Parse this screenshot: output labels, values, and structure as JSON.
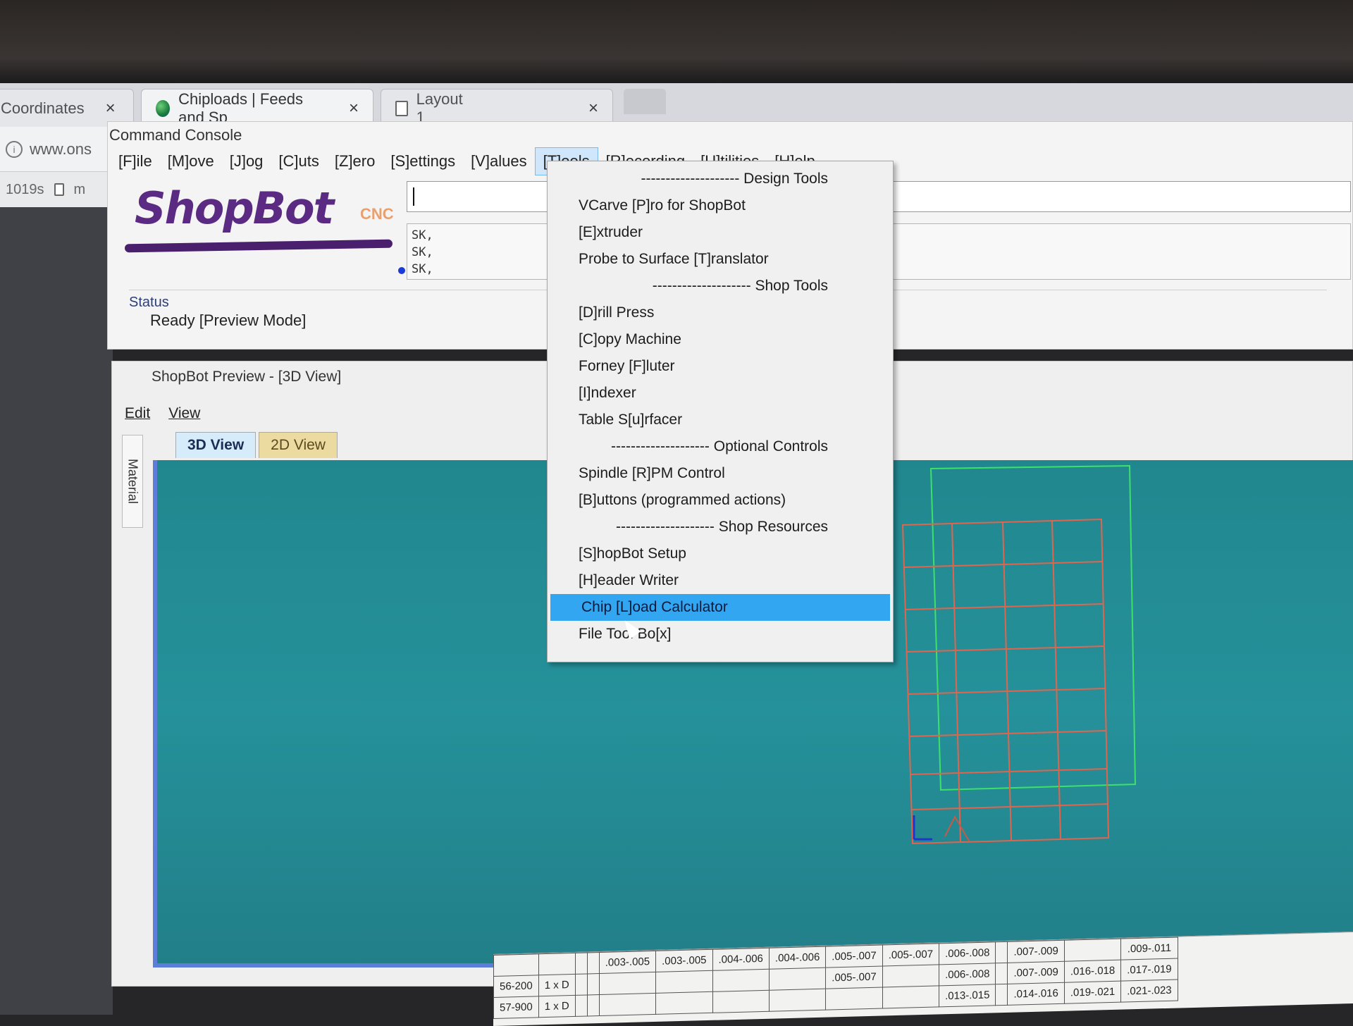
{
  "browser": {
    "tabs": [
      {
        "label": "Coordinates",
        "close": "×"
      },
      {
        "label": "Chiploads | Feeds and Sp",
        "close": "×"
      },
      {
        "label": "Layout 1",
        "close": "×"
      }
    ],
    "address": "www.ons",
    "bookmarks": [
      "1019s",
      "m"
    ]
  },
  "console": {
    "title": "Command Console",
    "menu": [
      "[F]ile",
      "[M]ove",
      "[J]og",
      "[C]uts",
      "[Z]ero",
      "[S]ettings",
      "[V]alues",
      "[T]ools",
      "[R]ecording",
      "[U]tilities",
      "[H]elp"
    ],
    "open_menu": "[T]ools",
    "logo_text": "ShopBot",
    "logo_suffix": "CNC",
    "history": [
      "SK,",
      "SK,",
      "SK,"
    ],
    "status_label": "Status",
    "status_text": "Ready  [Preview Mode]"
  },
  "preview": {
    "title": "ShopBot Preview - [3D View]",
    "menu": [
      "Edit",
      "View"
    ],
    "side_tab": "Material",
    "tabs": [
      "3D View",
      "2D View"
    ],
    "active_tab": "3D View"
  },
  "tools_menu": [
    {
      "type": "sep",
      "label": "-------------------- Design Tools"
    },
    {
      "type": "item",
      "label": "VCarve [P]ro for ShopBot"
    },
    {
      "type": "item",
      "label": "[E]xtruder"
    },
    {
      "type": "item",
      "label": "Probe to Surface [T]ranslator"
    },
    {
      "type": "sep",
      "label": "-------------------- Shop Tools"
    },
    {
      "type": "item",
      "label": "[D]rill Press"
    },
    {
      "type": "item",
      "label": "[C]opy Machine"
    },
    {
      "type": "item",
      "label": "Forney [F]luter"
    },
    {
      "type": "item",
      "label": "[I]ndexer"
    },
    {
      "type": "item",
      "label": "Table S[u]rfacer"
    },
    {
      "type": "sep",
      "label": "-------------------- Optional Controls"
    },
    {
      "type": "item",
      "label": "Spindle [R]PM Control"
    },
    {
      "type": "item",
      "label": "[B]uttons (programmed actions)"
    },
    {
      "type": "sep",
      "label": "-------------------- Shop Resources"
    },
    {
      "type": "item",
      "label": "[S]hopBot Setup"
    },
    {
      "type": "item",
      "label": "[H]eader Writer"
    },
    {
      "type": "item",
      "label": "Chip [L]oad Calculator",
      "highlighted": true
    },
    {
      "type": "item",
      "label": "File Tool Bo[x]"
    }
  ],
  "paper_chart": {
    "rows": [
      [
        "",
        "",
        "",
        "",
        ".003-.005",
        ".003-.005",
        ".004-.006",
        ".004-.006",
        ".005-.007",
        ".005-.007",
        ".006-.008",
        "",
        ".007-.009",
        "",
        ".009-.011"
      ],
      [
        "56-200",
        "1 x D",
        "",
        "",
        "",
        "",
        "",
        "",
        ".005-.007",
        "",
        ".006-.008",
        "",
        ".007-.009",
        ".016-.018",
        ".017-.019"
      ],
      [
        "57-900",
        "1 x D",
        "",
        "",
        "",
        "",
        "",
        "",
        "",
        "",
        ".013-.015",
        "",
        ".014-.016",
        ".019-.021",
        ".021-.023"
      ]
    ]
  },
  "colors": {
    "menu_open": "#cfe6fb",
    "highlight": "#33a6f2",
    "canvas": "#25919a",
    "logo": "#5b2a82",
    "grid_red": "#e0654f",
    "grid_green": "#3ee06a"
  }
}
